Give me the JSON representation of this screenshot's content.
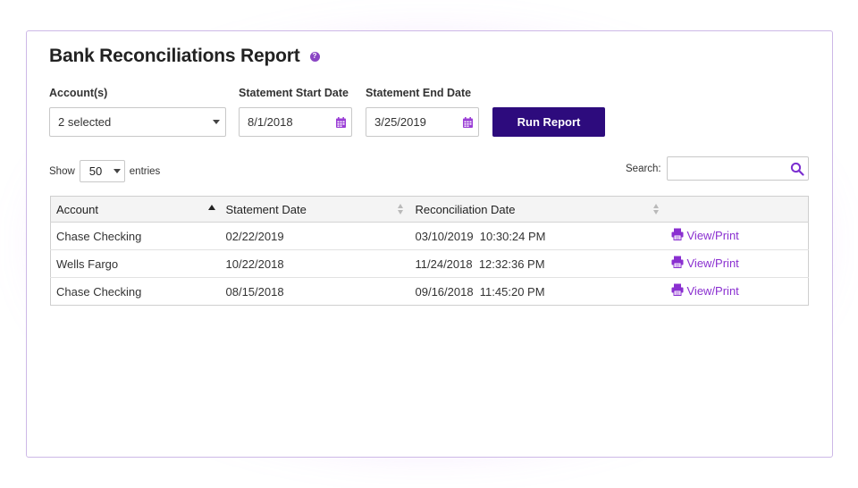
{
  "report": {
    "title": "Bank Reconciliations Report",
    "help_icon": "question-circle-icon",
    "help_glyph": "?"
  },
  "filters": {
    "accounts_label": "Account(s)",
    "accounts_value": "2 selected",
    "start_label": "Statement Start Date",
    "start_value": "8/1/2018",
    "end_label": "Statement End Date",
    "end_value": "3/25/2019",
    "calendar_icon": "calendar-icon"
  },
  "actions": {
    "run_label": "Run Report"
  },
  "length_control": {
    "show_label": "Show",
    "value": "50",
    "entries_label": "entries"
  },
  "search": {
    "label": "Search:",
    "value": "",
    "icon": "search-icon"
  },
  "table": {
    "headers": {
      "account": "Account",
      "statement_date": "Statement Date",
      "reconciliation_date": "Reconciliation Date",
      "action": ""
    },
    "rows": [
      {
        "account": "Chase Checking",
        "statement_date": "02/22/2019",
        "reconciliation_date": "03/10/2019  10:30:24 PM",
        "action": "View/Print"
      },
      {
        "account": "Wells Fargo",
        "statement_date": "10/22/2018",
        "reconciliation_date": "11/24/2018  12:32:36 PM",
        "action": "View/Print"
      },
      {
        "account": "Chase Checking",
        "statement_date": "08/15/2018",
        "reconciliation_date": "09/16/2018  11:45:20 PM",
        "action": "View/Print"
      }
    ]
  },
  "colors": {
    "accent": "#8a2fd0",
    "primary_button": "#2d0b7d",
    "card_border": "#cdb8e6",
    "glow": "#c478ff"
  }
}
